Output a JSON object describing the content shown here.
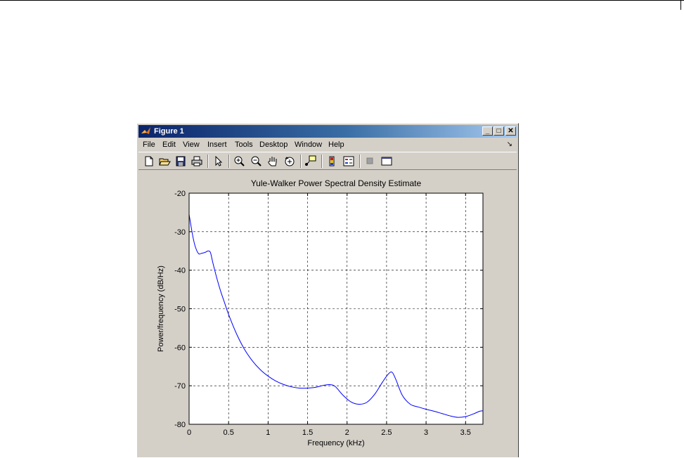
{
  "window": {
    "title": "Figure 1",
    "buttons": {
      "minimize": "_",
      "maximize": "□",
      "close": "✕"
    }
  },
  "menu": {
    "items": [
      "File",
      "Edit",
      "View",
      "Insert",
      "Tools",
      "Desktop",
      "Window",
      "Help"
    ],
    "dock_arrow": "↘"
  },
  "toolbar": {
    "icons": [
      "new-figure-icon",
      "open-file-icon",
      "save-icon",
      "print-icon",
      "edit-plot-arrow-icon",
      "zoom-in-icon",
      "zoom-out-icon",
      "pan-hand-icon",
      "rotate-3d-icon",
      "data-cursor-icon",
      "insert-colorbar-icon",
      "insert-legend-icon",
      "hide-plot-tools-icon",
      "show-plot-tools-icon"
    ]
  },
  "chart_data": {
    "type": "line",
    "title": "Yule-Walker Power Spectral Density Estimate",
    "xlabel": "Frequency (kHz)",
    "ylabel": "Power/frequency (dB/Hz)",
    "xlim": [
      0,
      3.72
    ],
    "ylim": [
      -80,
      -20
    ],
    "xticks": [
      0,
      0.5,
      1,
      1.5,
      2,
      2.5,
      3,
      3.5
    ],
    "xtick_labels": [
      "0",
      "0.5",
      "1",
      "1.5",
      "2",
      "2.5",
      "3",
      "3.5"
    ],
    "yticks": [
      -80,
      -70,
      -60,
      -50,
      -40,
      -30,
      -20
    ],
    "ytick_labels": [
      "-80",
      "-70",
      "-60",
      "-50",
      "-40",
      "-30",
      "-20"
    ],
    "grid": true,
    "line_color": "#0000ff",
    "series": [
      {
        "x": [
          0,
          0.02,
          0.05,
          0.08,
          0.12,
          0.16,
          0.2,
          0.24,
          0.27,
          0.3,
          0.35,
          0.4,
          0.45,
          0.5,
          0.6,
          0.7,
          0.8,
          0.9,
          1.0,
          1.1,
          1.2,
          1.3,
          1.4,
          1.5,
          1.6,
          1.7,
          1.78,
          1.85,
          1.95,
          2.05,
          2.15,
          2.25,
          2.35,
          2.45,
          2.52,
          2.57,
          2.62,
          2.7,
          2.8,
          2.9,
          3.0,
          3.1,
          3.2,
          3.3,
          3.4,
          3.5,
          3.6,
          3.68,
          3.72
        ],
        "y": [
          -25.5,
          -28,
          -31.5,
          -34,
          -35.7,
          -35.6,
          -35.4,
          -35.0,
          -35.4,
          -38,
          -42,
          -45.5,
          -48.5,
          -51.5,
          -56.5,
          -60.5,
          -63.5,
          -65.8,
          -67.5,
          -68.8,
          -69.7,
          -70.3,
          -70.6,
          -70.6,
          -70.4,
          -69.9,
          -69.7,
          -70.2,
          -72.5,
          -74.2,
          -74.8,
          -74.3,
          -72.2,
          -69.0,
          -67.0,
          -66.5,
          -68.5,
          -72.5,
          -74.8,
          -75.5,
          -76.1,
          -76.6,
          -77.2,
          -77.8,
          -78.2,
          -78.0,
          -77.3,
          -76.6,
          -76.5
        ]
      }
    ]
  }
}
